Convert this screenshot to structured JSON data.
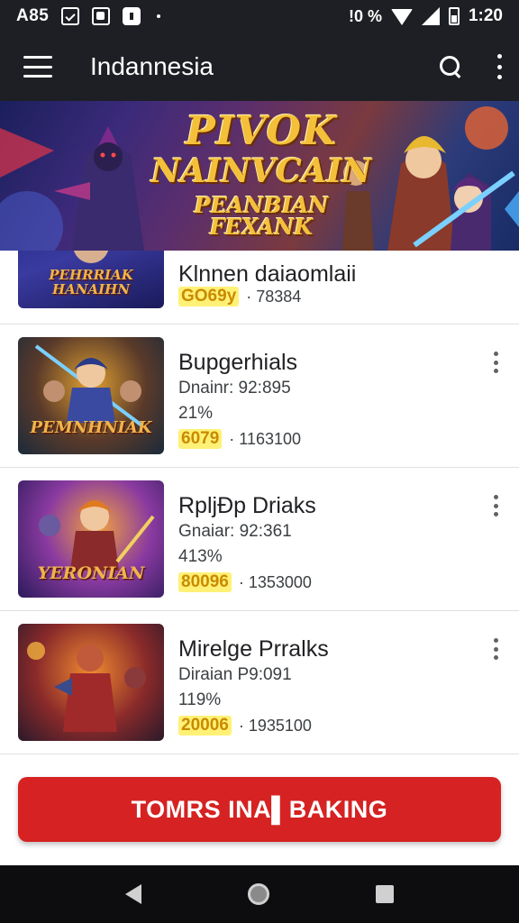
{
  "status_bar": {
    "left_text": "A85",
    "network_label": "!0 %",
    "time": "1:20",
    "icons": [
      "notification-check-icon",
      "notification-image-icon",
      "notification-app-icon",
      "wifi-icon",
      "signal-icon",
      "battery-icon"
    ]
  },
  "app_bar": {
    "title": "Indannesia",
    "icons": [
      "menu-icon",
      "search-icon",
      "more-vert-icon"
    ]
  },
  "banner": {
    "line1": "PIVOK",
    "line2": "NAINVCAIN",
    "line3": "PEANBIAN FEXANK"
  },
  "items": [
    {
      "thumb_caption": "PEHRRIAK HANAIHN",
      "title": "Klnnen daiaomlaii",
      "meta": "",
      "percent": "",
      "price": "GO69y",
      "count": "· 7⁣8384"
    },
    {
      "thumb_caption": "PEMNHNIAK",
      "title": "Bupgerhials",
      "meta": "Dnainr: 92:895",
      "percent": "21%",
      "price": "6079",
      "count": "· 1163100"
    },
    {
      "thumb_caption": "YERONIAN",
      "title": "RpljÐp Driaks",
      "meta": "Gnaiar: 92:361",
      "percent": "413%",
      "price": "80096",
      "count": "· 1353000"
    },
    {
      "thumb_caption": "",
      "title": "Mirelge Prralks",
      "meta": "Diraian P9:091",
      "percent": "119%",
      "price": "20006",
      "count": "· 1935100"
    }
  ],
  "cta": {
    "label": "TOMRS INA▌BAKING"
  },
  "nav_bar": {
    "icons": [
      "back-icon",
      "home-icon",
      "recents-icon"
    ]
  },
  "colors": {
    "app_bar": "#1d1f24",
    "cta": "#d62222",
    "price_badge": "#fff176",
    "nav_bar": "#0d0d0f"
  }
}
